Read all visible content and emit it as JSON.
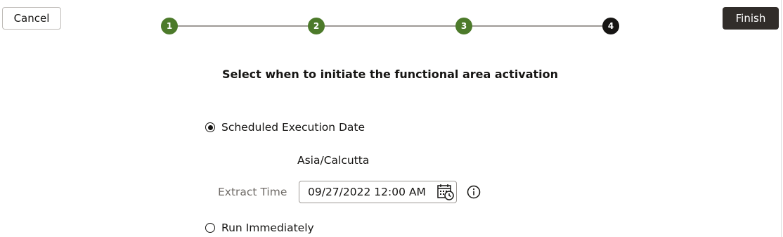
{
  "toolbar": {
    "cancel_label": "Cancel",
    "finish_label": "Finish"
  },
  "train": {
    "steps": [
      {
        "label": "1",
        "state": "completed"
      },
      {
        "label": "2",
        "state": "completed"
      },
      {
        "label": "3",
        "state": "completed"
      },
      {
        "label": "4",
        "state": "current"
      }
    ],
    "completed_color": "#4c7a2a",
    "current_color": "#161513"
  },
  "main": {
    "heading": "Select when to initiate the functional area activation",
    "options": {
      "scheduled": {
        "label": "Scheduled Execution Date",
        "selected": true
      },
      "immediate": {
        "label": "Run Immediately",
        "selected": false
      }
    },
    "timezone": "Asia/Calcutta",
    "extract_time": {
      "label": "Extract Time",
      "value": "09/27/2022 12:00 AM",
      "icon": "calendar-clock-icon"
    },
    "info_icon": "info-icon"
  }
}
